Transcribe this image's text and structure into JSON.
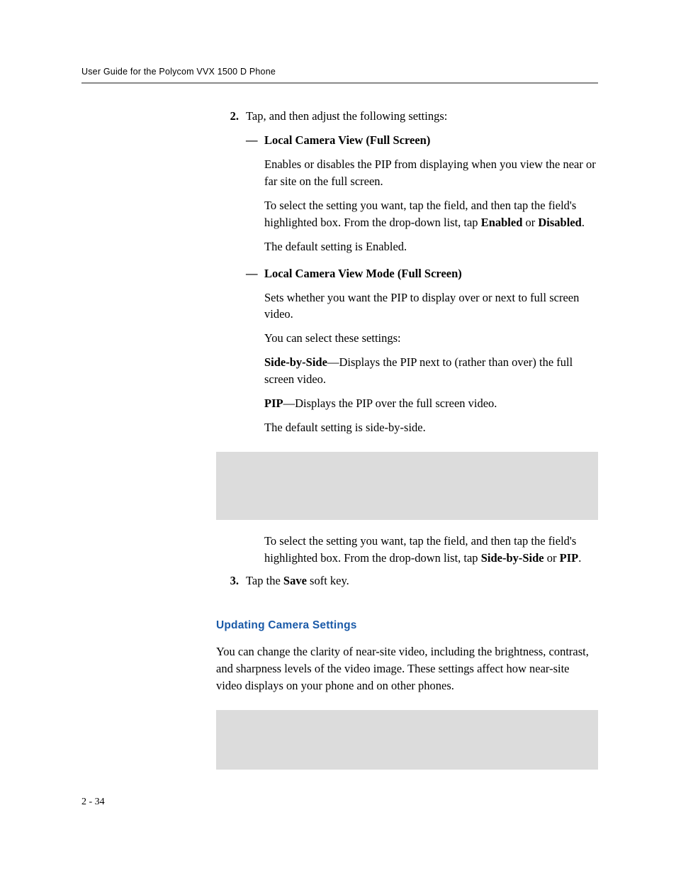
{
  "header": {
    "running_head": "User Guide for the Polycom VVX 1500 D Phone"
  },
  "step2": {
    "number": "2.",
    "intro": "Tap, and then adjust the following settings:",
    "itemA": {
      "dash": "—",
      "title": "Local Camera View (Full Screen)",
      "p1": "Enables or disables the PIP from displaying when you view the near or far site on the full screen.",
      "p2a": "To select the setting you want, tap the field, and then tap the field's highlighted box. From the drop-down list, tap ",
      "p2b_enabled": "Enabled",
      "p2c": " or ",
      "p2d_disabled": "Disabled",
      "p2e": ".",
      "p3": "The default setting is Enabled."
    },
    "itemB": {
      "dash": "—",
      "title": "Local Camera View Mode (Full Screen)",
      "p1": "Sets whether you want the PIP to display over or next to full screen video.",
      "p2": "You can select these settings:",
      "p3a_bold": "Side-by-Side",
      "p3b": "—Displays the PIP next to (rather than over) the full screen video.",
      "p4a_bold": "PIP",
      "p4b": "—Displays the PIP over the full screen video.",
      "p5": "The default setting is side-by-side.",
      "p6a": "To select the setting you want, tap the field, and then tap the field's highlighted box. From the drop-down list, tap ",
      "p6b_bold": "Side-by-Side",
      "p6c": " or ",
      "p6d_bold": "PIP",
      "p6e": "."
    }
  },
  "step3": {
    "number": "3.",
    "a": "Tap the ",
    "b_bold": "Save",
    "c": " soft key."
  },
  "section": {
    "heading": "Updating Camera Settings",
    "p1": "You can change the clarity of near-site video, including the brightness, contrast, and sharpness levels of the video image. These settings affect how near-site video displays on your phone and on other phones."
  },
  "footer": {
    "page_num": "2 - 34"
  }
}
